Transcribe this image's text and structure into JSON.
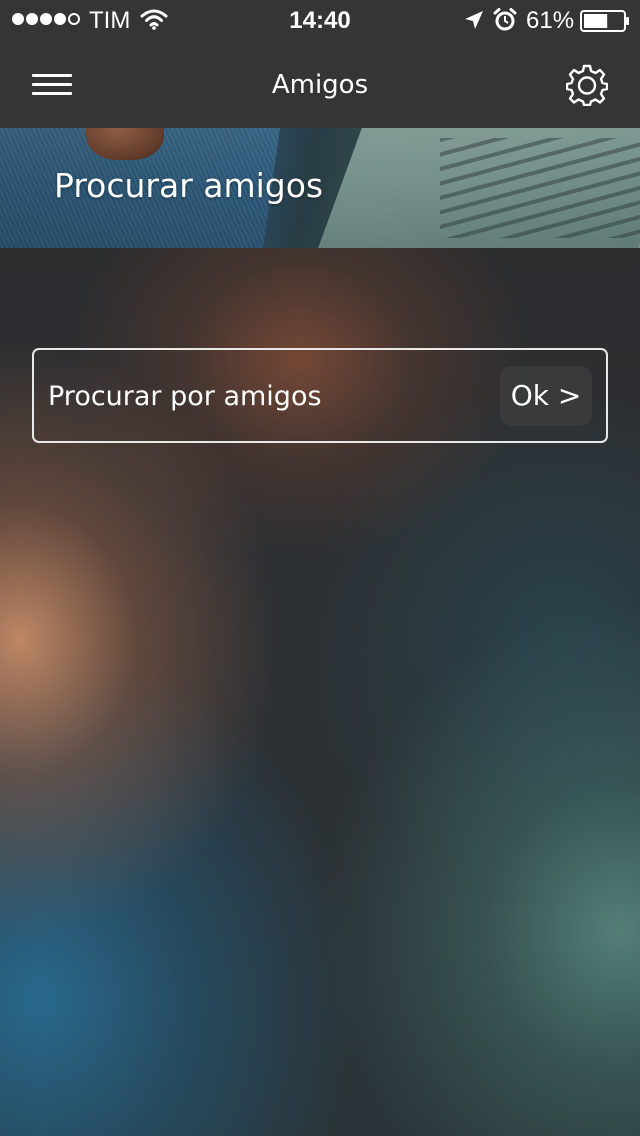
{
  "status_bar": {
    "carrier": "TIM",
    "time": "14:40",
    "battery_percent": "61%",
    "battery_level": 0.61,
    "signal_bars_filled": 4,
    "signal_bars_total": 5,
    "icons": [
      "wifi-icon",
      "location-arrow-icon",
      "alarm-clock-icon",
      "battery-icon"
    ]
  },
  "nav": {
    "title": "Amigos",
    "left_icon": "hamburger-menu-icon",
    "right_icon": "gear-icon"
  },
  "banner": {
    "title": "Procurar amigos"
  },
  "search": {
    "placeholder": "Procurar por amigos",
    "value": "",
    "button_label": "Ok >"
  },
  "colors": {
    "bar_background": "#353535",
    "text": "#ffffff",
    "search_border": "#e8e8e8",
    "button_background": "#3c3c3c"
  }
}
